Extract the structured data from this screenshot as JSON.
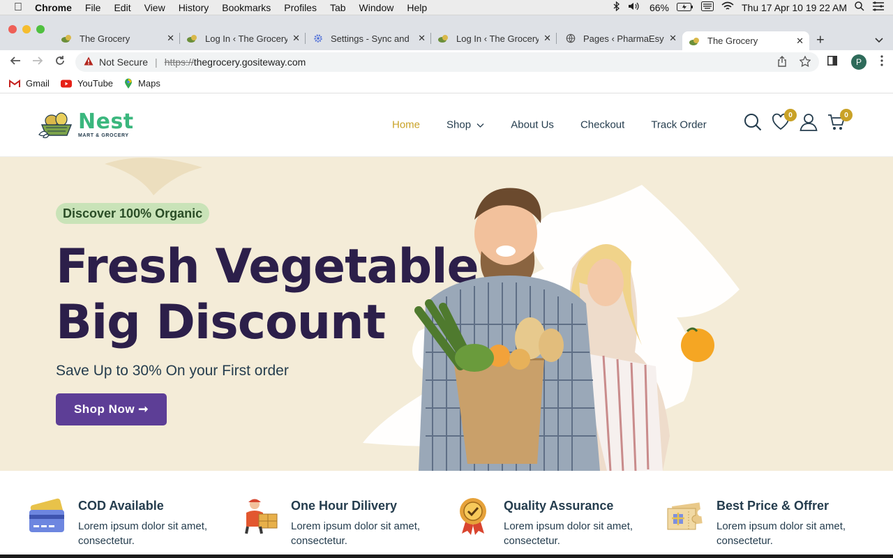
{
  "os_menubar": {
    "app_name": "Chrome",
    "menus": [
      "File",
      "Edit",
      "View",
      "History",
      "Bookmarks",
      "Profiles",
      "Tab",
      "Window",
      "Help"
    ],
    "battery": "66%",
    "datetime": "Thu 17 Apr  10 19 22 AM"
  },
  "tabs": [
    {
      "title": "The Grocery"
    },
    {
      "title": "Log In ‹ The Grocery"
    },
    {
      "title": "Settings - Sync and"
    },
    {
      "title": "Log In ‹ The Grocery"
    },
    {
      "title": "Pages ‹ PharmaEsy"
    },
    {
      "title": "The Grocery"
    }
  ],
  "address_bar": {
    "security": "Not Secure",
    "url_scheme": "https://",
    "url_host": "thegrocery.gositeway.com"
  },
  "profile_initial": "P",
  "bookmarks": [
    {
      "label": "Gmail"
    },
    {
      "label": "YouTube"
    },
    {
      "label": "Maps"
    }
  ],
  "site": {
    "logo": {
      "name": "Nest",
      "tagline": "MART & GROCERY"
    },
    "nav": [
      {
        "label": "Home"
      },
      {
        "label": "Shop"
      },
      {
        "label": "About Us"
      },
      {
        "label": "Checkout"
      },
      {
        "label": "Track Order"
      }
    ],
    "wishlist_count": "0",
    "cart_count": "0"
  },
  "hero": {
    "tagline": "Discover 100% Organic",
    "heading_line1": "Fresh Vegetable",
    "heading_line2": "Big Discount",
    "subtitle": "Save Up to 30% On your First order",
    "cta": "Shop Now ➞"
  },
  "features": [
    {
      "title": "COD Available",
      "desc": "Lorem ipsum dolor sit amet, consectetur.",
      "icon": "credit-card-icon"
    },
    {
      "title": "One Hour Dilivery",
      "desc": "Lorem ipsum dolor sit amet, consectetur.",
      "icon": "delivery-person-icon"
    },
    {
      "title": "Quality Assurance",
      "desc": "Lorem ipsum dolor sit amet, consectetur.",
      "icon": "quality-badge-icon"
    },
    {
      "title": "Best Price & Offrer",
      "desc": "Lorem ipsum dolor sit amet, consectetur.",
      "icon": "coupon-icon"
    }
  ],
  "colors": {
    "brand_green": "#3bb77e",
    "nav_active": "#c9a227",
    "hero_bg": "#f4ecd8",
    "heading": "#2c1f4a",
    "cta_bg": "#5d3e96"
  }
}
